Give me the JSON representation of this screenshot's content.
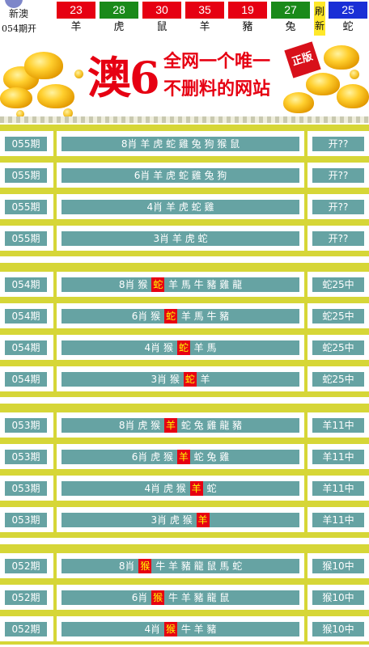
{
  "header": {
    "site_name": "新澳",
    "issue_label": "054期开",
    "refresh_label": "刷新",
    "balls": [
      {
        "number": "23",
        "zodiac": "羊",
        "color": "#e60012"
      },
      {
        "number": "28",
        "zodiac": "虎",
        "color": "#1a8a1a"
      },
      {
        "number": "30",
        "zodiac": "鼠",
        "color": "#e60012"
      },
      {
        "number": "35",
        "zodiac": "羊",
        "color": "#e60012"
      },
      {
        "number": "19",
        "zodiac": "豬",
        "color": "#e60012"
      },
      {
        "number": "27",
        "zodiac": "兔",
        "color": "#1a8a1a"
      },
      {
        "number": "25",
        "zodiac": "蛇",
        "color": "#1a2fd6"
      }
    ]
  },
  "banner": {
    "big_text": "澳6",
    "line1": "全网一个唯一",
    "line2": "不删料的网站",
    "stamp": "正版"
  },
  "groups": [
    {
      "rows": [
        {
          "issue": "055期",
          "prefix": "8肖",
          "parts": [
            "羊虎蛇雞兔狗猴鼠"
          ],
          "hit": "",
          "result": "开??"
        },
        {
          "issue": "055期",
          "prefix": "6肖",
          "parts": [
            "羊虎蛇雞兔狗"
          ],
          "hit": "",
          "result": "开??"
        },
        {
          "issue": "055期",
          "prefix": "4肖",
          "parts": [
            "羊虎蛇雞"
          ],
          "hit": "",
          "result": "开??"
        },
        {
          "issue": "055期",
          "prefix": "3肖",
          "parts": [
            "羊虎蛇"
          ],
          "hit": "",
          "result": "开??"
        }
      ]
    },
    {
      "rows": [
        {
          "issue": "054期",
          "prefix": "8肖",
          "before": "猴",
          "hit": "蛇",
          "after": "羊馬牛豬雞龍",
          "result": "蛇25中"
        },
        {
          "issue": "054期",
          "prefix": "6肖",
          "before": "猴",
          "hit": "蛇",
          "after": "羊馬牛豬",
          "result": "蛇25中"
        },
        {
          "issue": "054期",
          "prefix": "4肖",
          "before": "猴",
          "hit": "蛇",
          "after": "羊馬",
          "result": "蛇25中"
        },
        {
          "issue": "054期",
          "prefix": "3肖",
          "before": "猴",
          "hit": "蛇",
          "after": "羊",
          "result": "蛇25中"
        }
      ]
    },
    {
      "rows": [
        {
          "issue": "053期",
          "prefix": "8肖",
          "before": "虎猴",
          "hit": "羊",
          "after": "蛇兔雞龍豬",
          "result": "羊11中"
        },
        {
          "issue": "053期",
          "prefix": "6肖",
          "before": "虎猴",
          "hit": "羊",
          "after": "蛇兔雞",
          "result": "羊11中"
        },
        {
          "issue": "053期",
          "prefix": "4肖",
          "before": "虎猴",
          "hit": "羊",
          "after": "蛇",
          "result": "羊11中"
        },
        {
          "issue": "053期",
          "prefix": "3肖",
          "before": "虎猴",
          "hit": "羊",
          "after": "",
          "result": "羊11中"
        }
      ]
    },
    {
      "rows": [
        {
          "issue": "052期",
          "prefix": "8肖",
          "before": "",
          "hit": "猴",
          "after": "牛羊豬龍鼠馬蛇",
          "result": "猴10中"
        },
        {
          "issue": "052期",
          "prefix": "6肖",
          "before": "",
          "hit": "猴",
          "after": "牛羊豬龍鼠",
          "result": "猴10中"
        },
        {
          "issue": "052期",
          "prefix": "4肖",
          "before": "",
          "hit": "猴",
          "after": "牛羊豬",
          "result": "猴10中"
        }
      ]
    }
  ]
}
